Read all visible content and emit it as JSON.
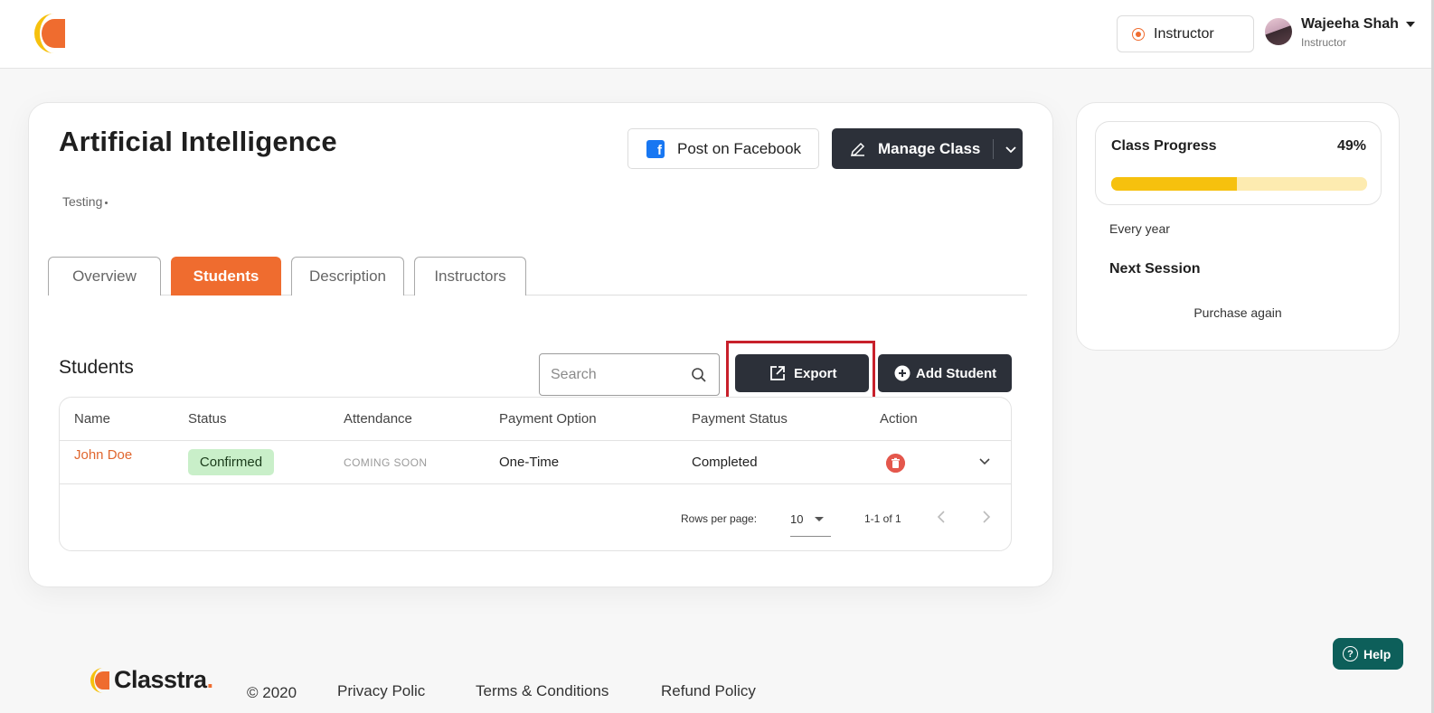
{
  "header": {
    "role_button": "Instructor",
    "user_name": "Wajeeha Shah",
    "user_role": "Instructor"
  },
  "course": {
    "title": "Artificial Intelligence",
    "subtitle": "Testing",
    "post_facebook": "Post on Facebook",
    "manage_class": "Manage Class"
  },
  "tabs": [
    "Overview",
    "Students",
    "Description",
    "Instructors"
  ],
  "active_tab": "Students",
  "students": {
    "section_title": "Students",
    "search_placeholder": "Search",
    "export_label": "Export",
    "add_label": "Add Student",
    "columns": [
      "Name",
      "Status",
      "Attendance",
      "Payment Option",
      "Payment Status",
      "Action"
    ],
    "rows": [
      {
        "name": "John Doe",
        "status": "Confirmed",
        "attendance": "COMING SOON",
        "payment_option": "One-Time",
        "payment_status": "Completed"
      }
    ],
    "pagination": {
      "rows_per_page_label": "Rows per page:",
      "rows_per_page": "10",
      "range": "1-1 of 1"
    }
  },
  "sidebar": {
    "progress_label": "Class Progress",
    "progress_text": "49%",
    "progress_value": 0.49,
    "frequency": "Every year",
    "next_session": "Next Session",
    "purchase_again": "Purchase again"
  },
  "help_label": "Help",
  "footer": {
    "brand": "Classtra",
    "brand_dot": ".",
    "copyright": "© 2020",
    "links": [
      "Privacy Polic",
      "Terms & Conditions",
      "Refund Policy"
    ]
  },
  "colors": {
    "accent": "#ef6c2f",
    "dark_button": "#2c3039",
    "progress_fill": "#f6c10e",
    "progress_track": "#fdebb0",
    "help": "#0d5f5a",
    "highlight": "#c8202b",
    "confirmed_badge": "#c9efc9"
  },
  "icons": [
    "logo-icon",
    "radio-icon",
    "avatar",
    "caret-down-icon",
    "facebook-icon",
    "pencil-icon",
    "chevron-down-icon",
    "search-icon",
    "export-icon",
    "plus-circle-icon",
    "trash-icon",
    "expand-icon",
    "chevron-left-icon",
    "chevron-right-icon",
    "help-icon"
  ]
}
